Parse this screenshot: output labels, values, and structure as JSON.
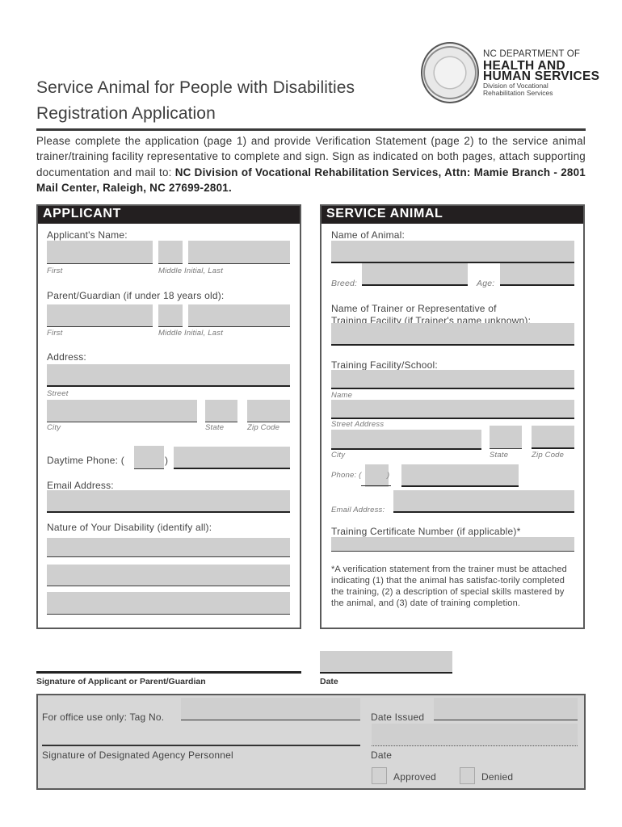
{
  "header": {
    "title_line1": "Service Animal for People with Disabilities",
    "title_line2": "Registration Application",
    "dept_line1": "NC DEPARTMENT OF",
    "dept_line2": "HEALTH AND",
    "dept_line3": "HUMAN SERVICES",
    "division_line1": "Division of Vocational",
    "division_line2": "Rehabilitation Services",
    "seal_icon": "nc-state-seal-icon"
  },
  "intro": {
    "text": "Please complete the application (page 1) and provide Verification Statement (page 2) to the service animal trainer/training facility representative to complete and sign. Sign as indicated on both pages, attach supporting documentation and mail to: ",
    "bold_text": "NC Division of Vocational Rehabilitation Services, Attn: Mamie Branch - 2801 Mail Center, Raleigh, NC 27699-2801."
  },
  "applicant": {
    "heading": "APPLICANT",
    "name_label": "Applicant's Name:",
    "first_label": "First",
    "middle_last_label": "Middle Initial, Last",
    "guardian_label": "Parent/Guardian (if under 18 years old):",
    "guardian_first_label": "First",
    "guardian_middle_last_label": "Middle Initial, Last",
    "address_label": "Address:",
    "street_label": "Street",
    "city_label": "City",
    "state_label": "State",
    "zip_label": "Zip Code",
    "phone_label": "Daytime Phone: (",
    "phone_paren_close": ")",
    "email_label": "Email Address:",
    "disability_label": "Nature of Your Disability (identify all):",
    "fields": {
      "first_name": "",
      "middle_initial": "",
      "last_name": "",
      "guardian_first": "",
      "guardian_middle": "",
      "guardian_last": "",
      "street": "",
      "city": "",
      "state": "",
      "zip": "",
      "area_code": "",
      "phone": "",
      "email": "",
      "disability_1": "",
      "disability_2": "",
      "disability_3": ""
    }
  },
  "service_animal": {
    "heading": "SERVICE ANIMAL",
    "animal_name_label": "Name of Animal:",
    "breed_label": "Breed:",
    "age_label": "Age:",
    "trainer_label_line1": "Name of Trainer or Representative of",
    "trainer_label_line2": "Training Facility (if Trainer's name unknown):",
    "facility_label": "Training Facility/School:",
    "name_sub": "Name",
    "street_sub": "Street Address",
    "city_sub": "City",
    "state_sub": "State",
    "zip_sub": "Zip Code",
    "phone_label": "Phone: (",
    "phone_paren_close": ")",
    "email_label": "Email Address:",
    "certificate_label": "Training Certificate Number (if applicable)*",
    "footnote": "*A verification statement from the trainer must be attached indicating (1) that the animal has satisfac-torily completed the training, (2) a description of special skills mastered by the animal, and (3) date of training completion.",
    "fields": {
      "animal_name": "",
      "breed": "",
      "age": "",
      "trainer": "",
      "facility_name": "",
      "facility_street": "",
      "facility_city": "",
      "facility_state": "",
      "facility_zip": "",
      "facility_area_code": "",
      "facility_phone": "",
      "facility_email": "",
      "certificate_number": ""
    }
  },
  "signature": {
    "applicant_sig_label": "Signature of Applicant or Parent/Guardian",
    "date_label": "Date",
    "date_value": ""
  },
  "office_use": {
    "tag_label": "For office use only: Tag No.",
    "date_issued_label": "Date Issued",
    "personnel_sig_label": "Signature of Designated Agency Personnel",
    "date_label": "Date",
    "approved_label": "Approved",
    "denied_label": "Denied",
    "approved_checked": false,
    "denied_checked": false
  }
}
